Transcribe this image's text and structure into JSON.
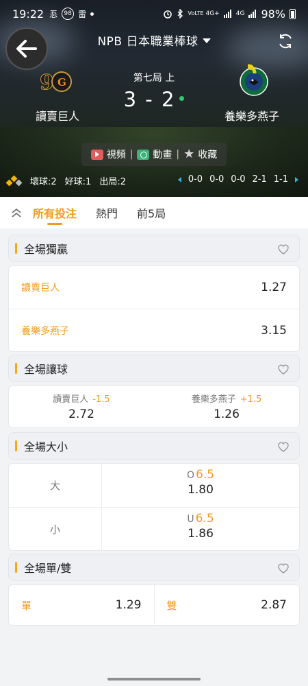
{
  "status_bar": {
    "time": "19:22",
    "left_icons": [
      "忢",
      "98",
      "雷",
      "•"
    ],
    "right_icons": [
      "alarm-icon",
      "bluetooth-icon",
      "VoLTE",
      "4G+",
      "signal-icon",
      "4G",
      "signal-icon"
    ],
    "battery": "98%"
  },
  "header": {
    "league": "NPB 日本職業棒球",
    "inning": "第七局 上",
    "score": "3 - 2",
    "home_team": "讀賣巨人",
    "away_team": "養樂多燕子",
    "actions": {
      "video": "視頻",
      "animation": "動畫",
      "favorite": "收藏"
    },
    "count": {
      "balls": "壞球:2",
      "strikes": "好球:1",
      "outs": "出局:2"
    },
    "innings_scores": [
      "0-0",
      "0-0",
      "0-0",
      "2-1",
      "1-1"
    ],
    "colors": {
      "accent": "#f39b1a",
      "live_dot": "#2ecc71",
      "nav_arrow": "#3fb0d8"
    }
  },
  "tabs": [
    "所有投注",
    "熱門",
    "前5局"
  ],
  "active_tab": "所有投注",
  "markets": {
    "winner": {
      "title": "全場獨贏",
      "rows": [
        {
          "name": "讀賣巨人",
          "odds": "1.27"
        },
        {
          "name": "養樂多燕子",
          "odds": "3.15"
        }
      ]
    },
    "handicap": {
      "title": "全場讓球",
      "home": {
        "name": "讀賣巨人",
        "line": "-1.5",
        "odds": "2.72"
      },
      "away": {
        "name": "養樂多燕子",
        "line": "+1.5",
        "odds": "1.26"
      }
    },
    "total": {
      "title": "全場大小",
      "over": {
        "label": "大",
        "prefix": "O",
        "line": "6.5",
        "odds": "1.80"
      },
      "under": {
        "label": "小",
        "prefix": "U",
        "line": "6.5",
        "odds": "1.86"
      }
    },
    "odd_even": {
      "title": "全場單/雙",
      "odd": {
        "label": "單",
        "odds": "1.29"
      },
      "even": {
        "label": "雙",
        "odds": "2.87"
      }
    }
  }
}
